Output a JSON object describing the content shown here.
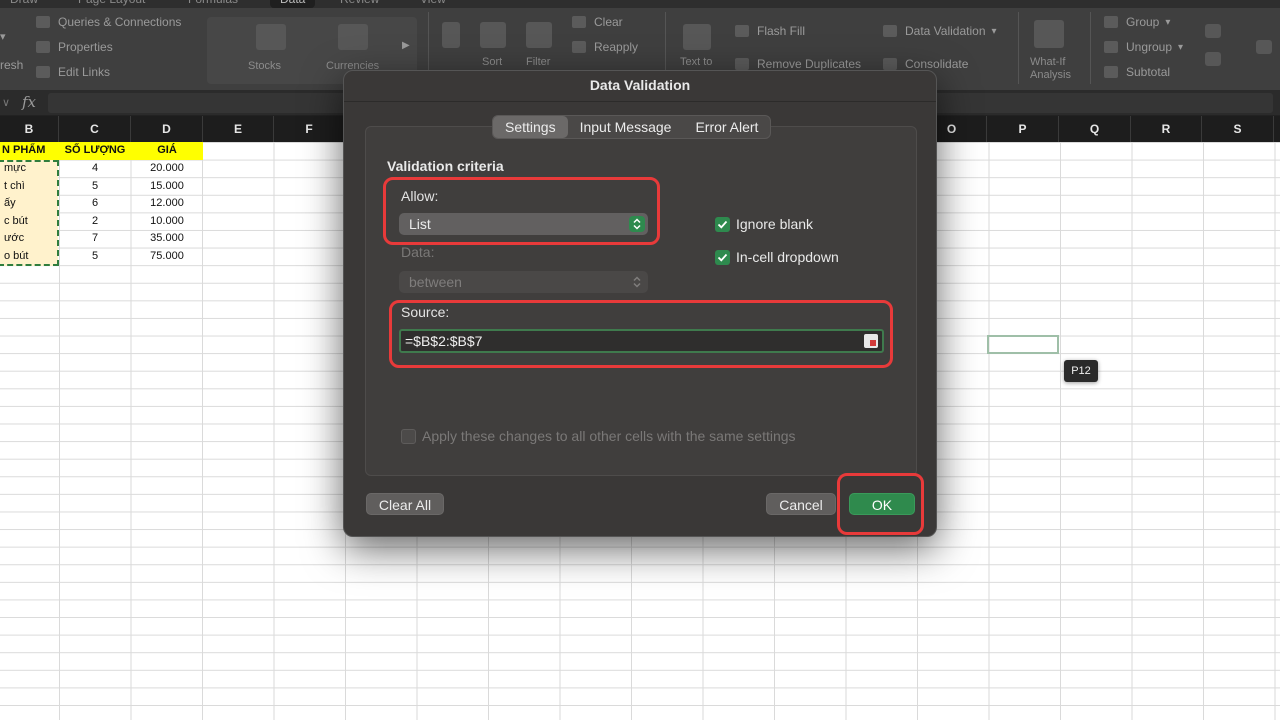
{
  "ribbon": {
    "tabs": [
      "Draw",
      "Page Layout",
      "Formulas",
      "Data",
      "Review",
      "View"
    ],
    "active_tab": "Data",
    "items": {
      "refresh": "resh",
      "queries_connections": "Queries & Connections",
      "properties": "Properties",
      "edit_links": "Edit Links",
      "stocks": "Stocks",
      "currencies": "Currencies",
      "sort": "Sort",
      "filter": "Filter",
      "clear": "Clear",
      "reapply": "Reapply",
      "text_to": "Text to",
      "flash_fill": "Flash Fill",
      "remove_duplicates": "Remove Duplicates",
      "data_validation": "Data Validation",
      "consolidate": "Consolidate",
      "what_if_1": "What-If",
      "what_if_2": "Analysis",
      "group": "Group",
      "ungroup": "Ungroup",
      "subtotal": "Subtotal"
    }
  },
  "formula_bar": {
    "fx": "fx",
    "value": ""
  },
  "columns": [
    "B",
    "C",
    "D",
    "E",
    "F",
    "",
    "",
    "",
    "",
    "",
    "",
    "",
    "",
    "O",
    "P",
    "Q",
    "R",
    "S"
  ],
  "sheet": {
    "header": [
      "N PHẨM",
      "SỐ LƯỢNG",
      "GIÁ"
    ],
    "rows": [
      [
        "mực",
        "4",
        "20.000"
      ],
      [
        "t chì",
        "5",
        "15.000"
      ],
      [
        "ấy",
        "6",
        "12.000"
      ],
      [
        "c bút",
        "2",
        "10.000"
      ],
      [
        "ước",
        "7",
        "35.000"
      ],
      [
        "o bút",
        "5",
        "75.000"
      ]
    ],
    "tooltip": "P12"
  },
  "dialog": {
    "title": "Data Validation",
    "tabs": [
      "Settings",
      "Input Message",
      "Error Alert"
    ],
    "selected_tab": "Settings",
    "criteria_heading": "Validation criteria",
    "allow_label": "Allow:",
    "allow_value": "List",
    "data_label": "Data:",
    "data_value": "between",
    "ignore_blank": "Ignore blank",
    "in_cell_dropdown": "In-cell dropdown",
    "source_label": "Source:",
    "source_value": "=$B$2:$B$7",
    "apply_all": "Apply these changes to all other cells with the same settings",
    "clear_all": "Clear All",
    "cancel": "Cancel",
    "ok": "OK"
  },
  "colors": {
    "accent_green": "#2f8a4d",
    "highlight_red": "#e83a3a",
    "header_yellow": "#ffff00",
    "input_yellow": "#fff2cc"
  }
}
